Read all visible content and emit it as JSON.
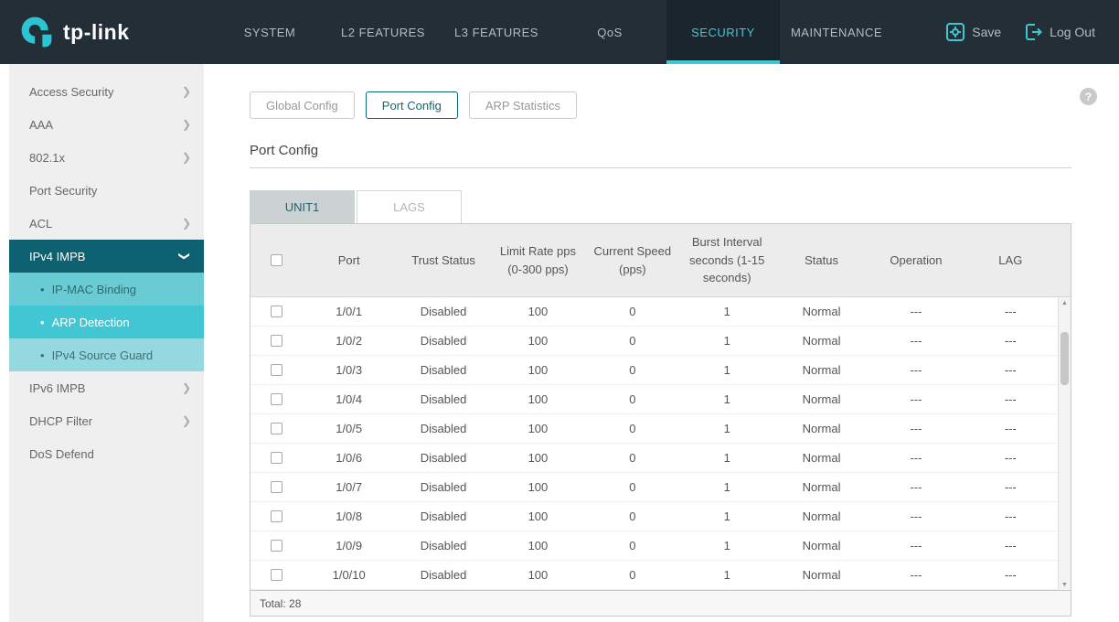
{
  "header": {
    "brand": "tp-link",
    "nav_items": [
      "SYSTEM",
      "L2 FEATURES",
      "L3 FEATURES",
      "QoS",
      "SECURITY",
      "MAINTENANCE"
    ],
    "active_nav": "SECURITY",
    "save_label": "Save",
    "logout_label": "Log Out"
  },
  "sidebar": {
    "items": [
      {
        "label": "Access Security",
        "type": "expandable"
      },
      {
        "label": "AAA",
        "type": "expandable"
      },
      {
        "label": "802.1x",
        "type": "expandable"
      },
      {
        "label": "Port Security",
        "type": "leaf"
      },
      {
        "label": "ACL",
        "type": "expandable"
      },
      {
        "label": "IPv4 IMPB",
        "type": "expanded-active"
      },
      {
        "label": "IP-MAC Binding",
        "type": "sub"
      },
      {
        "label": "ARP Detection",
        "type": "sub-active"
      },
      {
        "label": "IPv4 Source Guard",
        "type": "sub-light"
      },
      {
        "label": "IPv6 IMPB",
        "type": "expandable"
      },
      {
        "label": "DHCP Filter",
        "type": "expandable"
      },
      {
        "label": "DoS Defend",
        "type": "leaf"
      }
    ]
  },
  "main": {
    "tabs": [
      "Global Config",
      "Port Config",
      "ARP Statistics"
    ],
    "active_tab": "Port Config",
    "help_icon": "?",
    "section_title": "Port Config",
    "unit_tabs": [
      "UNIT1",
      "LAGS"
    ],
    "active_unit_tab": "UNIT1",
    "table": {
      "columns": [
        "Port",
        "Trust Status",
        "Limit Rate pps (0-300 pps)",
        "Current Speed (pps)",
        "Burst Interval seconds (1-15 seconds)",
        "Status",
        "Operation",
        "LAG"
      ],
      "field_names": [
        "port",
        "trust-status",
        "limit-rate",
        "current-speed",
        "burst-interval",
        "status",
        "operation",
        "lag"
      ],
      "rows": [
        [
          "1/0/1",
          "Disabled",
          "100",
          "0",
          "1",
          "Normal",
          "---",
          "---"
        ],
        [
          "1/0/2",
          "Disabled",
          "100",
          "0",
          "1",
          "Normal",
          "---",
          "---"
        ],
        [
          "1/0/3",
          "Disabled",
          "100",
          "0",
          "1",
          "Normal",
          "---",
          "---"
        ],
        [
          "1/0/4",
          "Disabled",
          "100",
          "0",
          "1",
          "Normal",
          "---",
          "---"
        ],
        [
          "1/0/5",
          "Disabled",
          "100",
          "0",
          "1",
          "Normal",
          "---",
          "---"
        ],
        [
          "1/0/6",
          "Disabled",
          "100",
          "0",
          "1",
          "Normal",
          "---",
          "---"
        ],
        [
          "1/0/7",
          "Disabled",
          "100",
          "0",
          "1",
          "Normal",
          "---",
          "---"
        ],
        [
          "1/0/8",
          "Disabled",
          "100",
          "0",
          "1",
          "Normal",
          "---",
          "---"
        ],
        [
          "1/0/9",
          "Disabled",
          "100",
          "0",
          "1",
          "Normal",
          "---",
          "---"
        ],
        [
          "1/0/10",
          "Disabled",
          "100",
          "0",
          "1",
          "Normal",
          "---",
          "---"
        ]
      ],
      "total_label": "Total: 28"
    },
    "colors": {
      "accent_teal": "#41c7d4",
      "topbar_bg": "#232e37",
      "active_parent_bg": "#0e6170",
      "sub_active_bg": "#41c7d4",
      "sidebar_bg": "#efeff0",
      "table_header_bg": "#ececec"
    }
  }
}
